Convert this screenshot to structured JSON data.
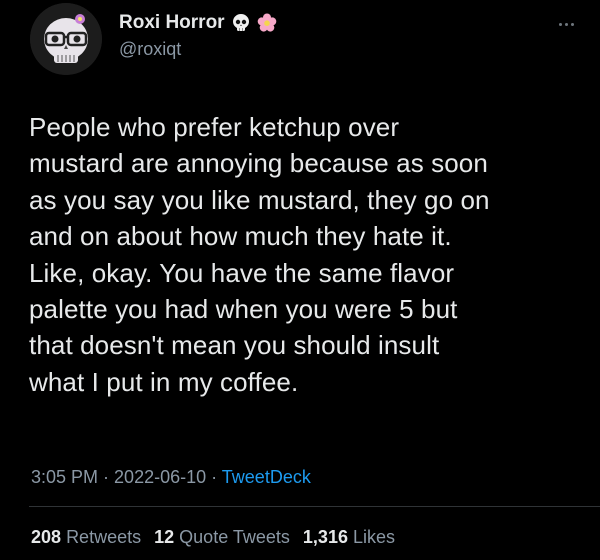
{
  "author": {
    "display_name": "Roxi Horror",
    "handle": "@roxiqt",
    "name_emojis": [
      "skull-emoji",
      "cherry-blossom-emoji"
    ],
    "avatar_icon": "skull-with-glasses-avatar"
  },
  "tweet": {
    "text": "People who prefer ketchup over\nmustard are annoying because as soon\nas you say you like mustard, they go on\nand on about how much they hate it.\nLike, okay. You have the same flavor\npalette you had when you were 5 but\nthat doesn't mean you should insult\nwhat I put in my coffee."
  },
  "meta": {
    "time": "3:05 PM",
    "sep1": " · ",
    "date": "2022-06-10",
    "sep2": " · ",
    "source": "TweetDeck"
  },
  "stats": {
    "retweets_count": "208",
    "retweets_label": "Retweets",
    "quotes_count": "12",
    "quotes_label": "Quote Tweets",
    "likes_count": "1,316",
    "likes_label": "Likes"
  },
  "colors": {
    "background": "#000000",
    "text_primary": "#e7e9ea",
    "text_secondary": "#8b98a5",
    "link": "#1d9bf0",
    "divider": "#2f3336"
  }
}
